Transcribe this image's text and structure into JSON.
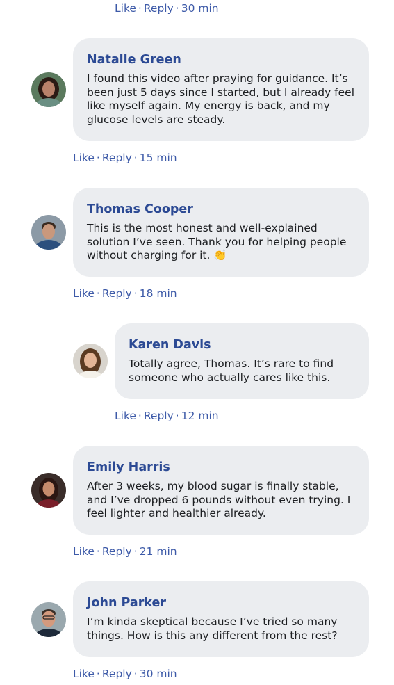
{
  "actions": {
    "like": "Like",
    "reply": "Reply",
    "separator": "·"
  },
  "top_reply": {
    "time": "30 min"
  },
  "comments": [
    {
      "name": "Natalie Green",
      "text": "I found this video after praying for guidance. It’s been just 5 days since I started, but I already feel like myself again. My energy is back, and my glucose levels are steady.",
      "time": "15 min",
      "avatar_colors": {
        "bg": "#5b7a5e",
        "skin": "#b9826a",
        "hair": "#2b1a14",
        "shirt": "#6a8f83"
      }
    },
    {
      "name": "Thomas Cooper",
      "text": "This is the most honest and well-explained solution I’ve seen. Thank you for helping people without charging for it. 👏",
      "time": "18 min",
      "avatar_colors": {
        "bg": "#8c9aa6",
        "skin": "#c9987c",
        "hair": "#3a2a20",
        "shirt": "#2c4f7d"
      }
    },
    {
      "name": "Karen Davis",
      "text": "Totally agree, Thomas. It’s rare to find someone who actually cares like this.",
      "time": "12 min",
      "avatar_colors": {
        "bg": "#d8d4cd",
        "skin": "#e3b597",
        "hair": "#5a3a22",
        "shirt": "#f4f1ea"
      }
    },
    {
      "name": "Emily Harris",
      "text": "After 3 weeks, my blood sugar is finally stable, and I’ve dropped 6 pounds without even trying. I feel lighter and healthier already.",
      "time": "21 min",
      "avatar_colors": {
        "bg": "#3a2d2a",
        "skin": "#c58b6c",
        "hair": "#2a1612",
        "shirt": "#7a1f2a"
      }
    },
    {
      "name": "John Parker",
      "text": "I’m kinda skeptical because I’ve tried so many things. How is this any different from the rest?",
      "time": "30 min",
      "avatar_colors": {
        "bg": "#9aa8ae",
        "skin": "#d49a7e",
        "hair": "#3b2f28",
        "shirt": "#1e2a3a"
      }
    }
  ]
}
